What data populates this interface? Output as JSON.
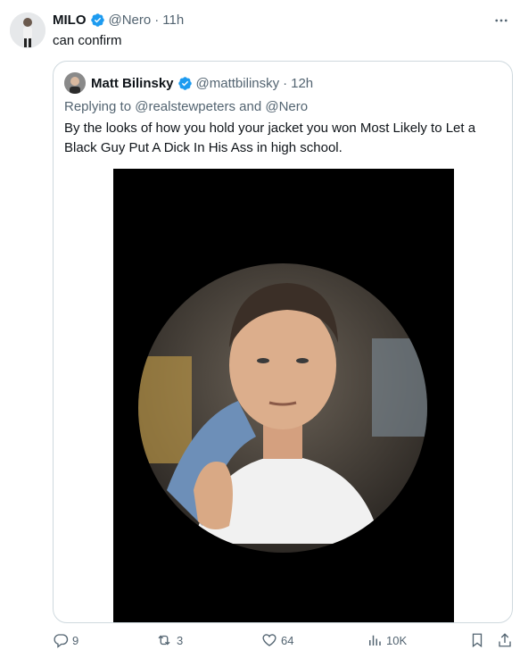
{
  "author": {
    "name": "MILO",
    "handle": "@Nero",
    "time": "11h",
    "dot": "·",
    "avatar_icon": "person-avatar"
  },
  "tweet": {
    "text": "can confirm"
  },
  "quoted": {
    "name": "Matt Bilinsky",
    "handle": "@mattbilinsky",
    "time": "12h",
    "dot": "·",
    "replying_prefix": "Replying to",
    "reply_user1": "@realstewpeters",
    "reply_and": "and",
    "reply_user2": "@Nero",
    "text_line1": "By the looks of how you hold your jacket you won Most Likely to Let a",
    "text_line2": "Black Guy Put A Dick In His Ass in high school."
  },
  "actions": {
    "replies": "9",
    "reposts": "3",
    "likes": "64",
    "views": "10K"
  },
  "icons": {
    "more": "more-dots-icon",
    "verified": "verified-badge-icon",
    "reply": "reply-icon",
    "repost": "repost-icon",
    "like": "heart-icon",
    "views": "views-icon",
    "bookmark": "bookmark-icon",
    "share": "share-icon"
  },
  "colors": {
    "verified_blue": "#1d9bf0",
    "secondary_text": "#536471",
    "border": "#cfd9de"
  }
}
